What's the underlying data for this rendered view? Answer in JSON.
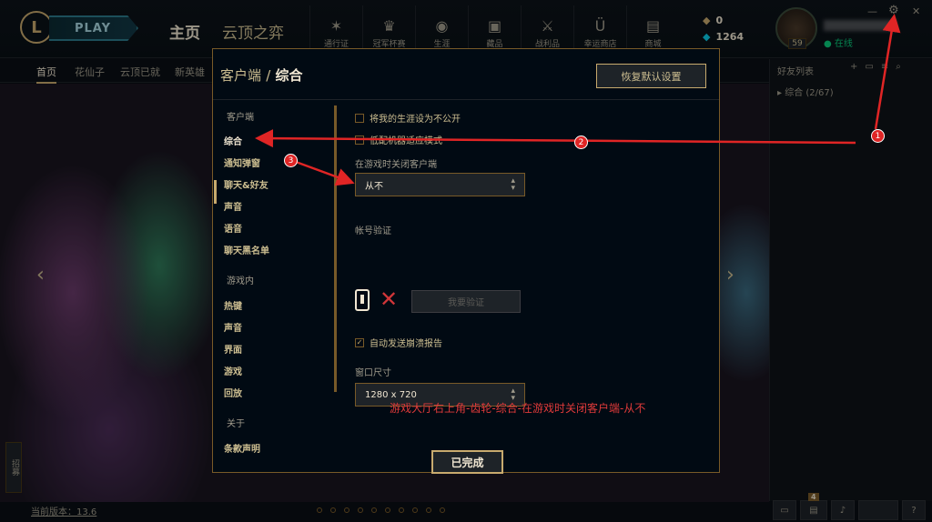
{
  "topbar": {
    "logo_letter": "L",
    "play_label": "PLAY",
    "home_tab": "主页",
    "tft_tab": "云顶之弈",
    "nav": [
      {
        "label": "通行证",
        "icon": "pass-icon",
        "glyph": "✶"
      },
      {
        "label": "冠军杯赛",
        "icon": "trophy-icon",
        "glyph": "♛"
      },
      {
        "label": "生涯",
        "icon": "profile-icon",
        "glyph": "◉"
      },
      {
        "label": "藏品",
        "icon": "collection-icon",
        "glyph": "▣"
      },
      {
        "label": "战利品",
        "icon": "loot-icon",
        "glyph": "⚔"
      },
      {
        "label": "幸运商店",
        "icon": "lucky-shop-icon",
        "glyph": "Ü"
      },
      {
        "label": "商城",
        "icon": "store-icon",
        "glyph": "▤"
      }
    ],
    "rp_value": "0",
    "be_value": "1264",
    "level": "59",
    "status": "在线",
    "minimize": "—",
    "gear": "⚙",
    "close": "✕"
  },
  "subnav": [
    "首页",
    "花仙子",
    "云顶已就",
    "新英雄"
  ],
  "version_text": "当前版本：13.6",
  "side_tab_text": "招募",
  "friends": {
    "title": "好友列表",
    "group": "综合 (2/67)",
    "badge": "4"
  },
  "modal": {
    "crumb": "客户端",
    "separator": "/",
    "title": "综合",
    "restore_label": "恢复默认设置",
    "sections": {
      "client": "客户端",
      "ingame": "游戏内",
      "about": "关于"
    },
    "client_items": [
      "综合",
      "通知弹窗",
      "聊天&好友",
      "声音",
      "语音",
      "聊天黑名单"
    ],
    "ingame_items": [
      "热键",
      "声音",
      "界面",
      "游戏",
      "回放"
    ],
    "about_items": [
      "条款声明"
    ],
    "options": {
      "private_profile": "将我的生涯设为不公开",
      "low_spec": "低配机器适应模式",
      "close_client_label": "在游戏时关闭客户端",
      "close_client_value": "从不",
      "account_verify_label": "帐号验证",
      "verify_button": "我要验证",
      "auto_crash_report": "自动发送崩溃报告",
      "window_size_label": "窗口尺寸",
      "window_size_value": "1280 x 720"
    },
    "instruction": "游戏大厅右上角-齿轮-综合-在游戏时关闭客户端-从不",
    "done_label": "已完成"
  },
  "annotations": [
    "1",
    "2",
    "3"
  ],
  "colors": {
    "gold": "#c8aa6e",
    "annotation_red": "#e02525",
    "online_green": "#0acb7c"
  }
}
